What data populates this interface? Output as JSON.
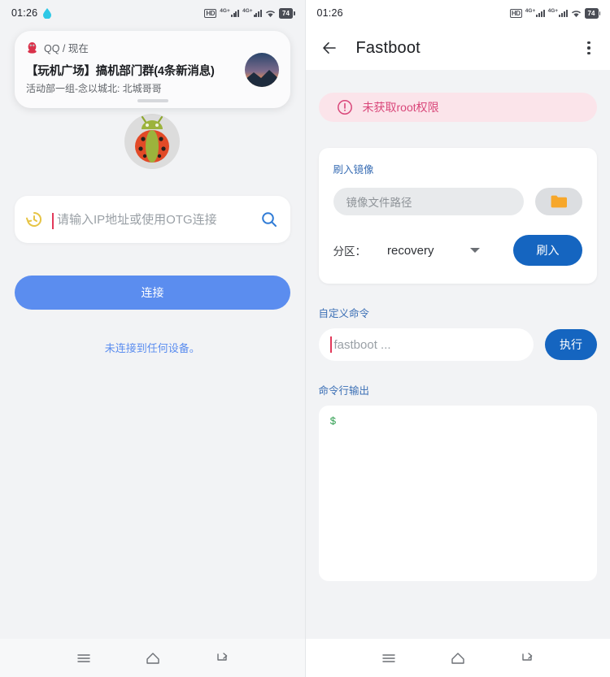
{
  "left": {
    "statusbar": {
      "time": "01:26",
      "drop_icon": "water-drop-icon",
      "hd_label": "HD",
      "network_label": "4G+",
      "battery_level": "74"
    },
    "notification": {
      "app_icon": "qq-penguin-icon",
      "app_line": "QQ / 现在",
      "title": "【玩机广场】搞机部门群(4条新消息)",
      "subtitle": "活动部一组-念以城北: 北城哥哥",
      "thumbnail": "landscape-thumbnail"
    },
    "app_icon": "ladybug-android-icon",
    "search": {
      "history_icon": "history-icon",
      "placeholder": "请输入IP地址或使用OTG连接",
      "value": "",
      "search_icon": "search-icon"
    },
    "connect_button": "连接",
    "connection_status": "未连接到任何设备。",
    "nav": {
      "recents": "menu-icon",
      "home": "home-icon",
      "back": "back-icon"
    }
  },
  "right": {
    "statusbar": {
      "time": "01:26",
      "hd_label": "HD",
      "network_label": "4G+",
      "battery_level": "74"
    },
    "toolbar": {
      "back_icon": "arrow-left-icon",
      "title": "Fastboot",
      "overflow_icon": "kebab-menu-icon"
    },
    "banner": {
      "icon": "alert-circle-icon",
      "text": "未获取root权限"
    },
    "flash_card": {
      "label": "刷入镜像",
      "path_placeholder": "镜像文件路径",
      "path_value": "",
      "folder_icon": "folder-icon",
      "partition_label": "分区：",
      "partition_value": "recovery",
      "dropdown_icon": "chevron-down-icon",
      "flash_button": "刷入"
    },
    "custom_command": {
      "label": "自定义命令",
      "placeholder": "fastboot ...",
      "value": "",
      "exec_button": "执行"
    },
    "console": {
      "label": "命令行输出",
      "content": "$"
    },
    "nav": {
      "recents": "menu-icon",
      "home": "home-icon",
      "back": "back-icon"
    }
  },
  "colors": {
    "accent_blue": "#5b8def",
    "deep_blue": "#1565c0",
    "link_blue": "#3b6fb5",
    "error_pink": "#d9477a",
    "banner_bg": "#fbe4ea",
    "console_green": "#2e9e4f",
    "page_bg": "#f2f3f5"
  }
}
